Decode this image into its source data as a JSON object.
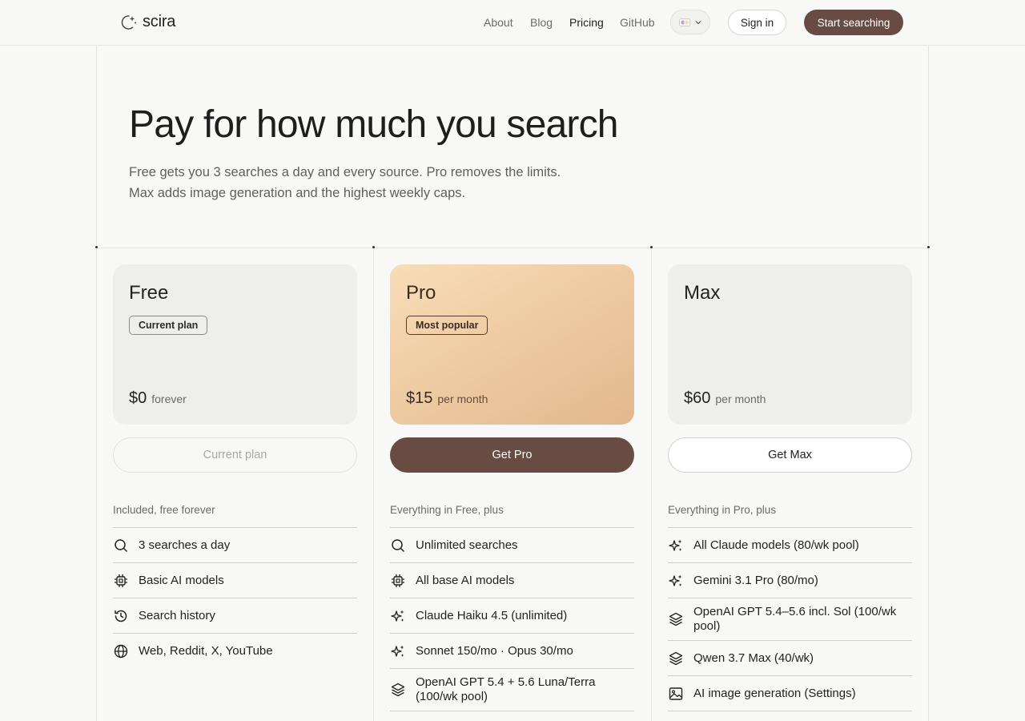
{
  "nav": {
    "brand": "scira",
    "links": [
      {
        "label": "About"
      },
      {
        "label": "Blog"
      },
      {
        "label": "Pricing"
      },
      {
        "label": "GitHub"
      }
    ],
    "signin_label": "Sign in",
    "start_label": "Start searching"
  },
  "hero": {
    "title": "Pay for how much you search",
    "subtitle": "Free gets you 3 searches a day and every source. Pro removes the limits. Max adds image generation and the highest weekly caps."
  },
  "plans": [
    {
      "name": "Free",
      "badge": "Current plan",
      "price": "$0",
      "period": "forever",
      "cta": "Current plan",
      "features_heading": "Included, free forever",
      "features": [
        {
          "icon": "search-icon",
          "label": "3 searches a day"
        },
        {
          "icon": "cpu-icon",
          "label": "Basic AI models"
        },
        {
          "icon": "history-icon",
          "label": "Search history"
        },
        {
          "icon": "globe-icon",
          "label": "Web, Reddit, X, YouTube"
        }
      ]
    },
    {
      "name": "Pro",
      "badge": "Most popular",
      "price": "$15",
      "period": "per month",
      "cta": "Get Pro",
      "features_heading": "Everything in Free, plus",
      "features": [
        {
          "icon": "search-icon",
          "label": "Unlimited searches"
        },
        {
          "icon": "cpu-icon",
          "label": "All base AI models"
        },
        {
          "icon": "sparkles-icon",
          "label": "Claude Haiku 4.5 (unlimited)"
        },
        {
          "icon": "sparkles-icon",
          "label": "Sonnet 150/mo · Opus 30/mo"
        },
        {
          "icon": "layers-icon",
          "label": "OpenAI GPT 5.4 + 5.6 Luna/Terra (100/wk pool)"
        }
      ]
    },
    {
      "name": "Max",
      "badge": "",
      "price": "$60",
      "period": "per month",
      "cta": "Get Max",
      "features_heading": "Everything in Pro, plus",
      "features": [
        {
          "icon": "sparkles-icon",
          "label": "All Claude models (80/wk pool)"
        },
        {
          "icon": "sparkles-icon",
          "label": "Gemini 3.1 Pro (80/mo)"
        },
        {
          "icon": "layers-icon",
          "label": "OpenAI GPT 5.4–5.6 incl. Sol (100/wk pool)"
        },
        {
          "icon": "layers-icon",
          "label": "Qwen 3.7 Max (40/wk)"
        },
        {
          "icon": "image-icon",
          "label": "AI image generation (Settings)"
        }
      ]
    }
  ],
  "colors": {
    "accent": "#684b42",
    "background": "#f8f8f7",
    "pro_gradient_start": "#f8ddb8",
    "pro_gradient_end": "#e2b88e"
  }
}
